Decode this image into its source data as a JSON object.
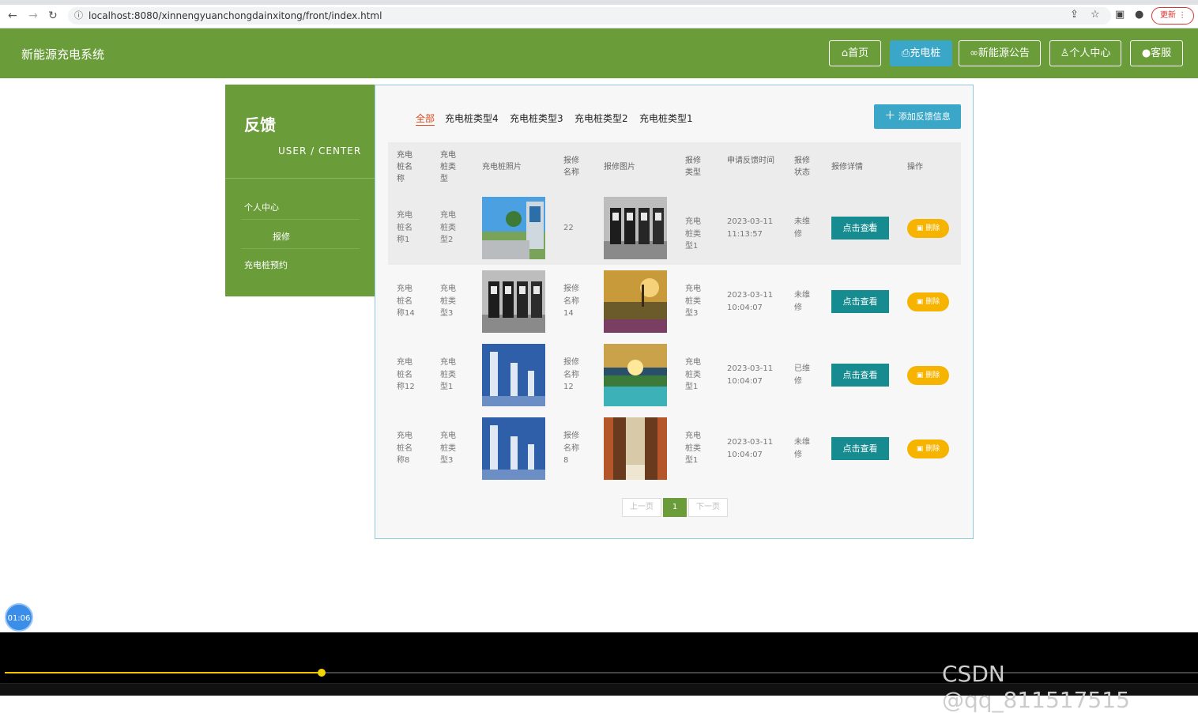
{
  "browser": {
    "url": "localhost:8080/xinnengyuanchongdainxitong/front/index.html",
    "update_label": "更新"
  },
  "header": {
    "brand": "新能源充电系统",
    "nav": [
      {
        "label": "首页",
        "icon": "home-icon",
        "active": false
      },
      {
        "label": "充电桩",
        "icon": "print-icon",
        "active": true
      },
      {
        "label": "新能源公告",
        "icon": "link-icon",
        "active": false
      },
      {
        "label": "个人中心",
        "icon": "user-icon",
        "active": false
      },
      {
        "label": "客服",
        "icon": "chat-icon",
        "active": false
      }
    ]
  },
  "sidebar": {
    "title": "反馈",
    "subtitle": "USER / CENTER",
    "items": [
      "个人中心",
      "报修",
      "充电桩预约"
    ]
  },
  "categories": [
    "全部",
    "充电桩类型4",
    "充电桩类型3",
    "充电桩类型2",
    "充电桩类型1"
  ],
  "add_button": "添加反馈信息",
  "table": {
    "headers": [
      "充电桩名称",
      "充电桩类型",
      "充电桩照片",
      "报修名称",
      "报修图片",
      "报修类型",
      "申请反馈时间",
      "报修状态",
      "报修详情",
      "操作"
    ],
    "rows": [
      {
        "name": "充电桩名称1",
        "type": "充电桩类型2",
        "repair_name": "22",
        "repair_type": "充电桩类型1",
        "time": "2023-03-11 11:13:57",
        "status": "未维修",
        "view": "点击查看",
        "del": "删除"
      },
      {
        "name": "充电桩名称14",
        "type": "充电桩类型3",
        "repair_name": "报修名称14",
        "repair_type": "充电桩类型3",
        "time": "2023-03-11 10:04:07",
        "status": "未维修",
        "view": "点击查看",
        "del": "删除"
      },
      {
        "name": "充电桩名称12",
        "type": "充电桩类型1",
        "repair_name": "报修名称12",
        "repair_type": "充电桩类型1",
        "time": "2023-03-11 10:04:07",
        "status": "已维修",
        "view": "点击查看",
        "del": "删除"
      },
      {
        "name": "充电桩名称8",
        "type": "充电桩类型3",
        "repair_name": "报修名称8",
        "repair_type": "充电桩类型1",
        "time": "2023-03-11 10:04:07",
        "status": "未维修",
        "view": "点击查看",
        "del": "删除"
      }
    ]
  },
  "pager": {
    "prev": "上一页",
    "current": "1",
    "next": "下一页"
  },
  "recorder": {
    "time": "01:06"
  },
  "watermark": "CSDN @qq_811517515",
  "colors": {
    "brand_green": "#6a9d3a",
    "accent_blue": "#3aa6c8",
    "view_teal": "#168b90",
    "delete_amber": "#f6b400"
  }
}
